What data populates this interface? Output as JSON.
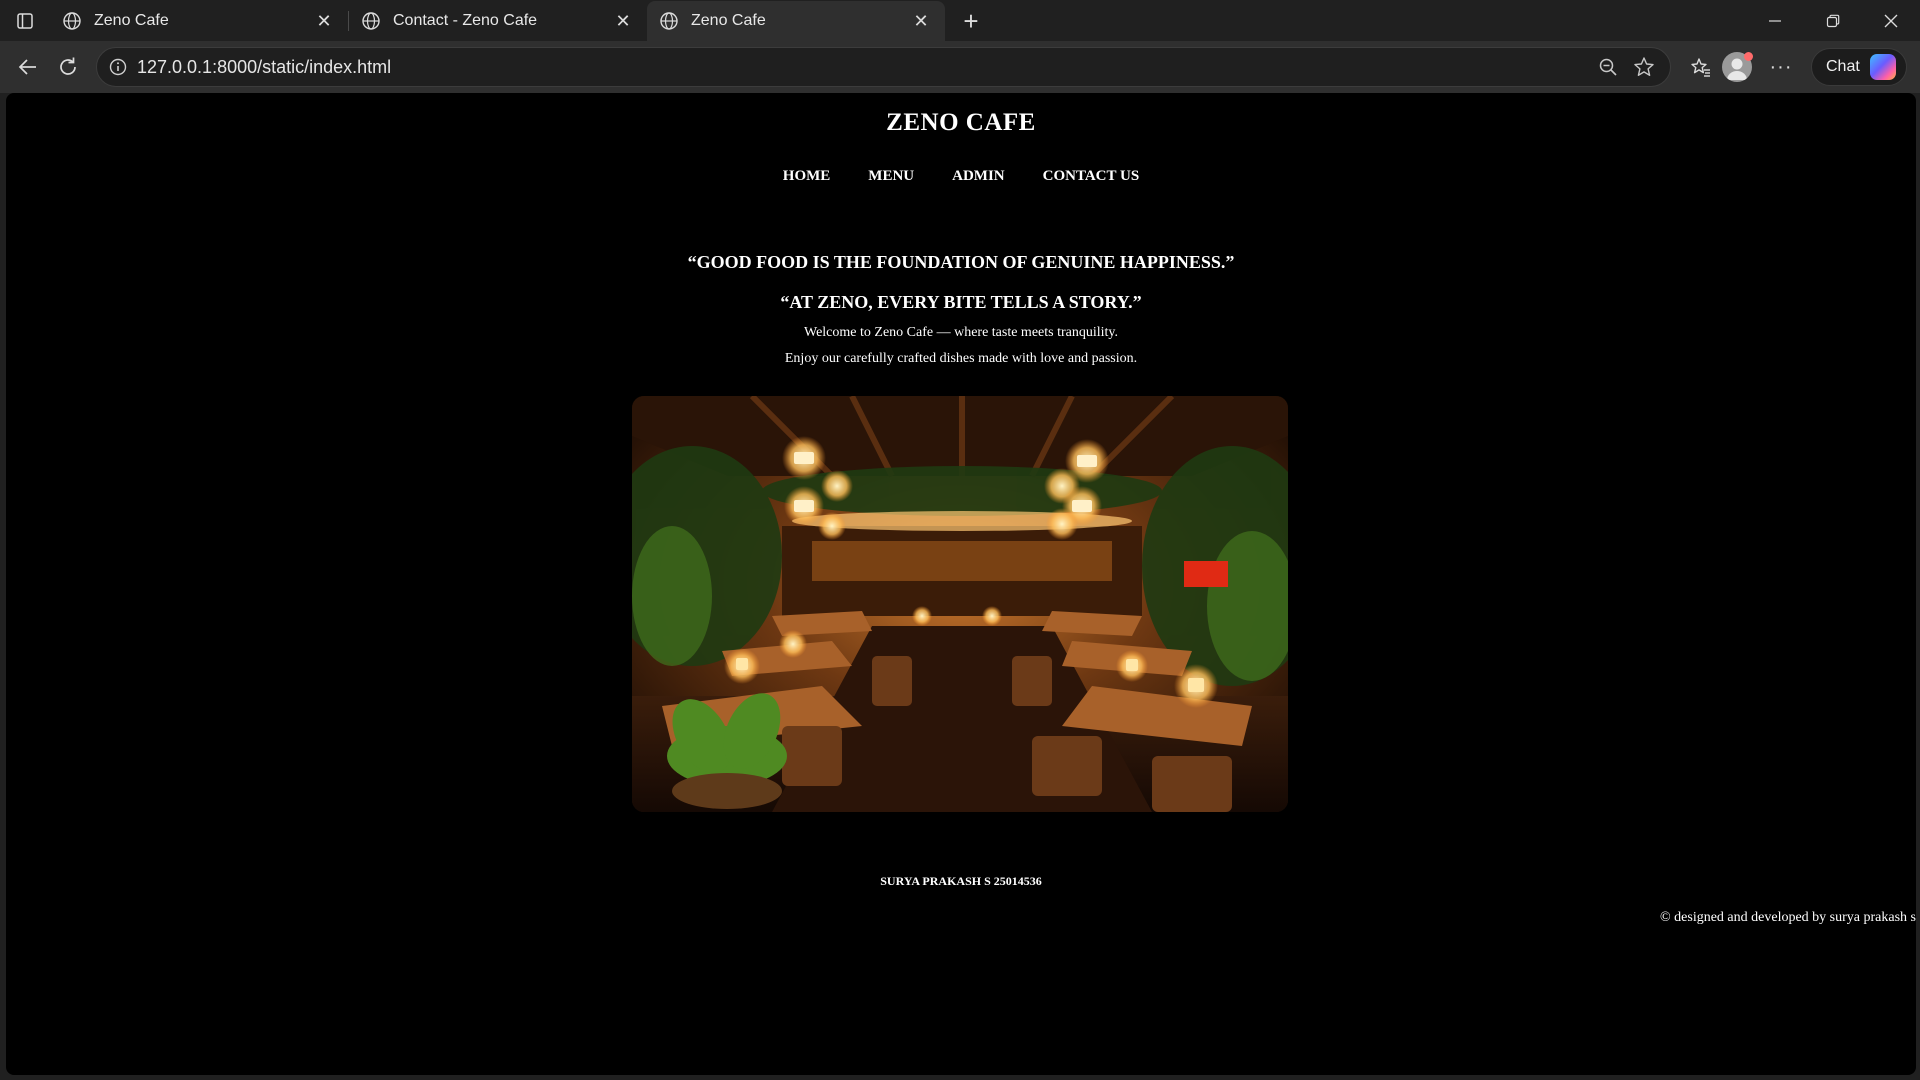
{
  "browser": {
    "tabs": [
      {
        "title": "Zeno Cafe",
        "active": false
      },
      {
        "title": "Contact - Zeno Cafe",
        "active": false
      },
      {
        "title": "Zeno Cafe",
        "active": true
      }
    ],
    "url": "127.0.0.1:8000/static/index.html",
    "chat_label": "Chat"
  },
  "site": {
    "title": "ZENO CAFE",
    "nav": [
      "HOME",
      "MENU",
      "ADMIN",
      "CONTACT US"
    ],
    "quote1": "“GOOD FOOD IS THE FOUNDATION OF GENUINE HAPPINESS.”",
    "quote2": "“AT ZENO, EVERY BITE TELLS A STORY.”",
    "welcome": "Welcome to Zeno Cafe — where taste meets tranquility.",
    "enjoy": "Enjoy our carefully crafted dishes made with love and passion.",
    "author": "SURYA PRAKASH S 25014536",
    "copyright": "© designed and developed by surya prakash s"
  }
}
